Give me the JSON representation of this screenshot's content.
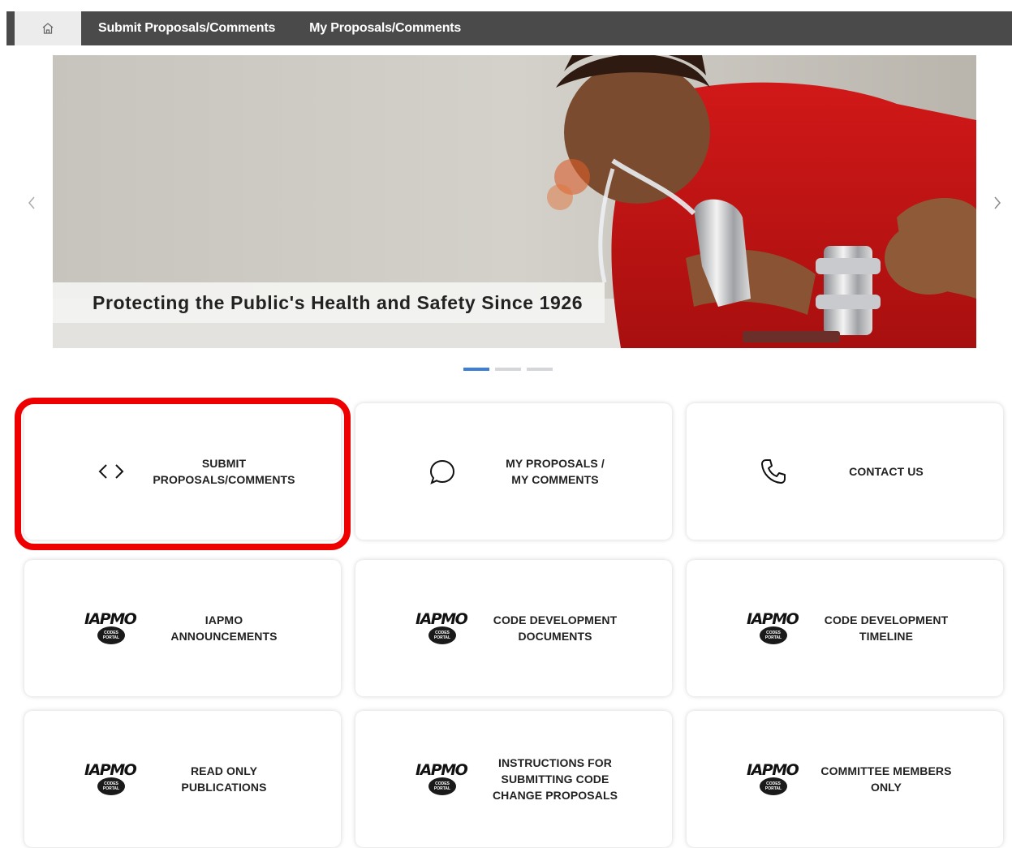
{
  "nav": {
    "home_icon": "home-icon",
    "links": [
      "Submit Proposals/Comments",
      "My Proposals/Comments"
    ]
  },
  "carousel": {
    "caption": "Protecting the Public's Health and Safety Since 1926",
    "prev_icon": "chevron-left-icon",
    "next_icon": "chevron-right-icon",
    "slide_count": 3,
    "active_slide": 1
  },
  "tiles": [
    {
      "lines": [
        "SUBMIT",
        "PROPOSALS/COMMENTS"
      ],
      "icon": "code-brackets-icon"
    },
    {
      "lines": [
        "MY PROPOSALS /",
        "MY COMMENTS"
      ],
      "icon": "chat-bubble-icon"
    },
    {
      "lines": [
        "CONTACT US"
      ],
      "icon": "phone-icon"
    },
    {
      "lines": [
        "IAPMO",
        "ANNOUNCEMENTS"
      ],
      "icon": "iapmo-logo"
    },
    {
      "lines": [
        "CODE DEVELOPMENT",
        "DOCUMENTS"
      ],
      "icon": "iapmo-logo"
    },
    {
      "lines": [
        "CODE DEVELOPMENT",
        "TIMELINE"
      ],
      "icon": "iapmo-logo"
    },
    {
      "lines": [
        "READ ONLY",
        "PUBLICATIONS"
      ],
      "icon": "iapmo-logo"
    },
    {
      "lines": [
        "INSTRUCTIONS FOR",
        "SUBMITTING CODE",
        "CHANGE PROPOSALS"
      ],
      "icon": "iapmo-logo"
    },
    {
      "lines": [
        "COMMITTEE MEMBERS",
        "ONLY"
      ],
      "icon": "iapmo-logo"
    }
  ],
  "logo": {
    "word": "IAPMO",
    "badge_top": "CODES",
    "badge_bottom": "PORTAL"
  },
  "colors": {
    "nav_bg": "#4a4a4a",
    "highlight": "#ee0000",
    "indicator_active": "#3d7ed8"
  }
}
